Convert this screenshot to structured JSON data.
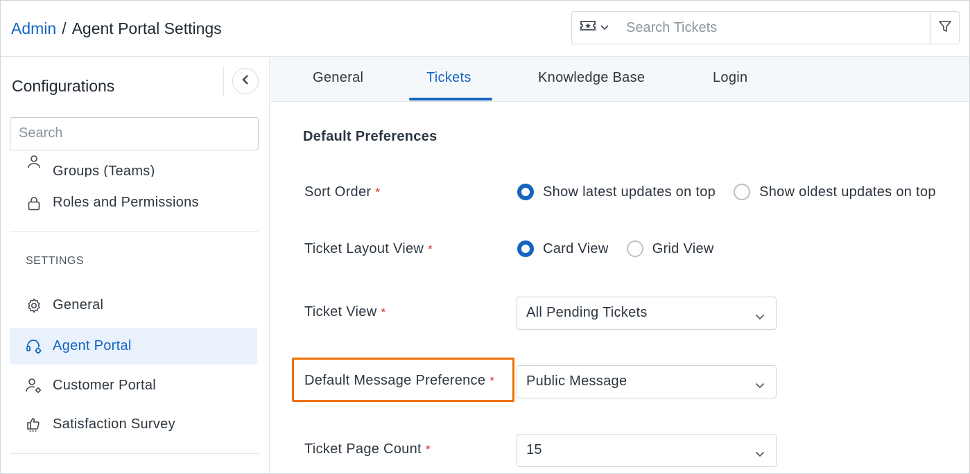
{
  "header": {
    "breadcrumb_root": "Admin",
    "breadcrumb_sep": "/",
    "breadcrumb_current": "Agent Portal Settings",
    "search_placeholder": "Search Tickets"
  },
  "sidebar": {
    "title": "Configurations",
    "search_placeholder": "Search",
    "partial_item": "Groups (Teams)",
    "roles_item": "Roles and Permissions",
    "section_label": "SETTINGS",
    "items": [
      {
        "label": "General",
        "icon": "gear-icon"
      },
      {
        "label": "Agent Portal",
        "icon": "headset-gear-icon",
        "active": true
      },
      {
        "label": "Customer Portal",
        "icon": "user-gear-icon"
      },
      {
        "label": "Satisfaction Survey",
        "icon": "thumbs-up-stars-icon"
      }
    ]
  },
  "tabs": [
    {
      "label": "General"
    },
    {
      "label": "Tickets",
      "active": true
    },
    {
      "label": "Knowledge Base"
    },
    {
      "label": "Login"
    }
  ],
  "form": {
    "section_title": "Default Preferences",
    "required_mark": "*",
    "sort_order": {
      "label": "Sort Order",
      "options": [
        "Show latest updates on top",
        "Show oldest updates on top"
      ],
      "selected": "Show latest updates on top"
    },
    "layout_view": {
      "label": "Ticket Layout View",
      "options": [
        "Card View",
        "Grid View"
      ],
      "selected": "Card View"
    },
    "ticket_view": {
      "label": "Ticket View",
      "value": "All Pending Tickets"
    },
    "message_pref": {
      "label": "Default Message Preference",
      "value": "Public Message"
    },
    "page_count": {
      "label": "Ticket Page Count",
      "value": "15"
    }
  },
  "colors": {
    "accent": "#1565c0",
    "highlight": "#f07100",
    "required": "#d62b2b"
  }
}
